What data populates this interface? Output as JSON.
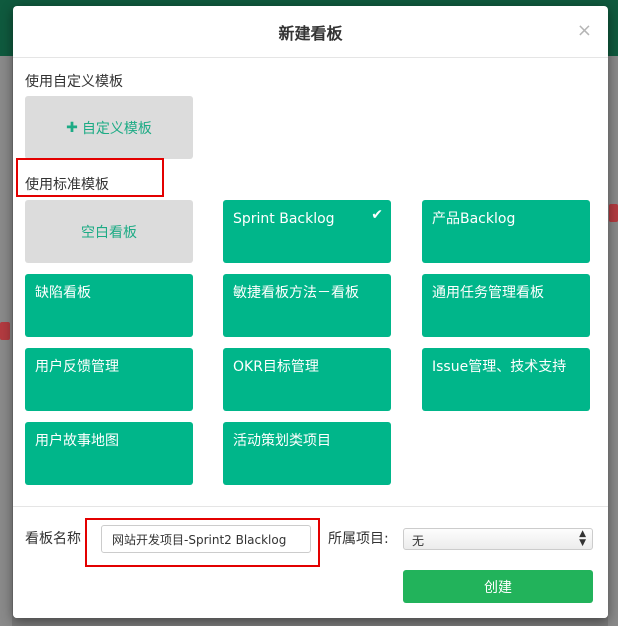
{
  "modal": {
    "title": "新建看板",
    "close": "×"
  },
  "custom": {
    "section_label": "使用自定义模板",
    "add_icon": "plus-icon",
    "add_label": "自定义模板"
  },
  "standard": {
    "section_label": "使用标准模板",
    "templates": [
      {
        "label": "空白看板",
        "style": "gray",
        "selected": false
      },
      {
        "label": "Sprint Backlog",
        "style": "green",
        "selected": true
      },
      {
        "label": "产品Backlog",
        "style": "green",
        "selected": false
      },
      {
        "label": "缺陷看板",
        "style": "green",
        "selected": false
      },
      {
        "label": "敏捷看板方法－看板",
        "style": "green",
        "selected": false
      },
      {
        "label": "通用任务管理看板",
        "style": "green",
        "selected": false
      },
      {
        "label": "用户反馈管理",
        "style": "green",
        "selected": false
      },
      {
        "label": "OKR目标管理",
        "style": "green",
        "selected": false
      },
      {
        "label": "Issue管理、技术支持",
        "style": "green",
        "selected": false
      },
      {
        "label": "用户故事地图",
        "style": "green",
        "selected": false
      },
      {
        "label": "活动策划类项目",
        "style": "green",
        "selected": false
      }
    ],
    "check": "✔"
  },
  "footer": {
    "name_label": "看板名称",
    "name_value": "网站开发项目-Sprint2 Blacklog",
    "project_label": "所属项目:",
    "project_value": "无",
    "create_label": "创建"
  },
  "colors": {
    "tile_green": "#00b68a",
    "tile_gray": "#dcdcdc",
    "button_green": "#22b35b",
    "highlight_red": "#e30000"
  }
}
